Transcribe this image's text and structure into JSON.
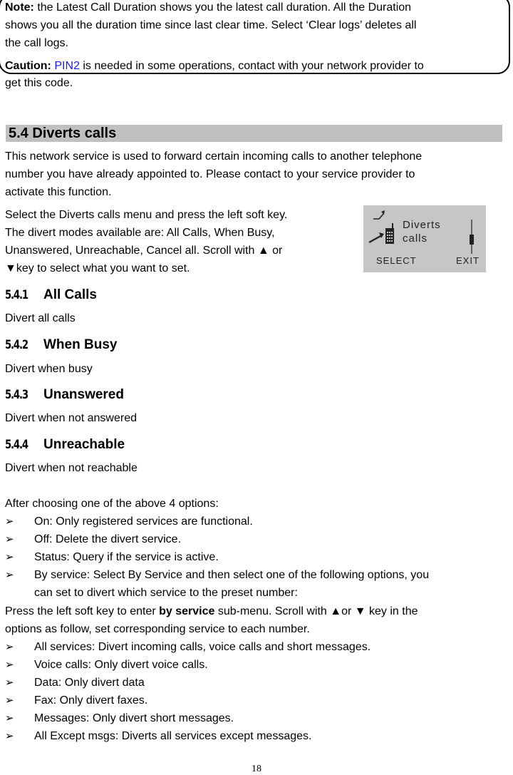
{
  "note": {
    "label": "Note:",
    "line1": " the Latest Call Duration shows you the latest call duration. All the Duration",
    "line2": "shows you all the duration time since last clear time. Select ‘Clear logs’ deletes all",
    "line3": "the call logs.",
    "caution_label": "Caution:",
    "caution_link": "PIN2",
    "caution_text": " is needed in some operations, contact with your network provider to",
    "caution_line2": "get this code."
  },
  "section": {
    "title": "5.4 Diverts calls",
    "intro": [
      "This network service is used to forward certain incoming calls to another telephone",
      "number you have already appointed to. Please contact to your service provider to",
      "activate this function."
    ],
    "instructions": [
      "Select the Diverts calls menu and press the left soft key.",
      "The divert modes available are: All Calls, When Busy,",
      "Unanswered, Unreachable, Cancel all. Scroll with ▲ or",
      "▼key to select what you want to set."
    ]
  },
  "phone_screen": {
    "menu_line1": "Diverts",
    "menu_line2": "calls",
    "left_softkey": "SELECT",
    "right_softkey": "EXIT"
  },
  "subsections": [
    {
      "number": "5.4.1",
      "title": "All Calls",
      "text": "Divert all calls"
    },
    {
      "number": "5.4.2",
      "title": "When Busy",
      "text": "Divert when busy"
    },
    {
      "number": "5.4.3",
      "title": "Unanswered",
      "text": "Divert when not answered"
    },
    {
      "number": "5.4.4",
      "title": "Unreachable",
      "text": "Divert when not reachable"
    }
  ],
  "options": {
    "intro": "After choosing one of the above 4 options:",
    "bullet_glyph": "➢",
    "items": [
      "On: Only registered services are functional.",
      "Off: Delete the divert service.",
      "Status: Query if the service is active.",
      "By service: Select By Service and then select one of the following options, you"
    ],
    "item4_cont": "can set to divert which service to the preset number:"
  },
  "by_service": {
    "pre": "Press the left soft key to enter ",
    "bold": "by service",
    "post": " sub-menu. Scroll with ▲or ▼ key in the",
    "line2": "options as follow, set corresponding service to each number.",
    "items": [
      "All services: Divert incoming calls, voice calls and short messages.",
      "Voice calls: Only divert voice calls.",
      "Data: Only divert data",
      "Fax: Only divert faxes.",
      "Messages: Only divert short messages.",
      "All Except msgs: Diverts all services except messages."
    ]
  },
  "page_number": "18"
}
